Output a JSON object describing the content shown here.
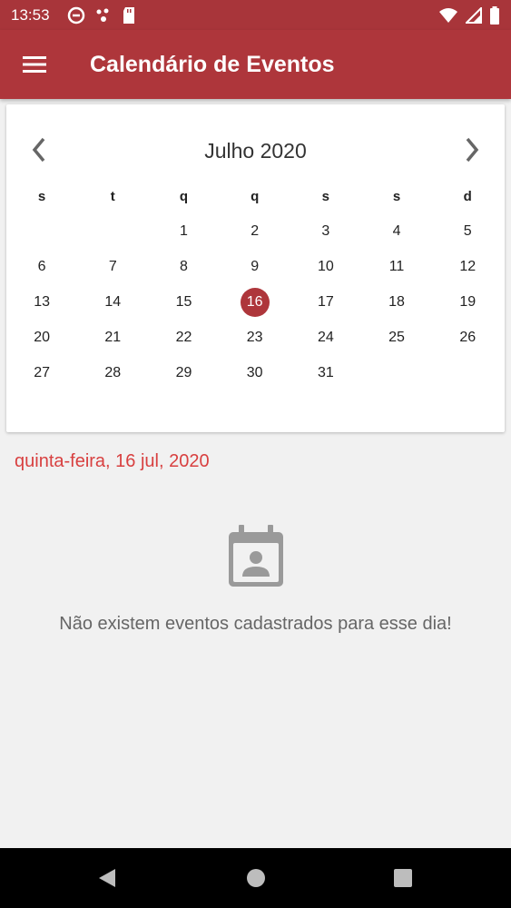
{
  "status_bar": {
    "time": "13:53"
  },
  "app_bar": {
    "title": "Calendário de Eventos"
  },
  "calendar": {
    "month_label": "Julho 2020",
    "weekdays": [
      "s",
      "t",
      "q",
      "q",
      "s",
      "s",
      "d"
    ],
    "days": [
      "",
      "",
      "1",
      "2",
      "3",
      "4",
      "5",
      "6",
      "7",
      "8",
      "9",
      "10",
      "11",
      "12",
      "13",
      "14",
      "15",
      "16",
      "17",
      "18",
      "19",
      "20",
      "21",
      "22",
      "23",
      "24",
      "25",
      "26",
      "27",
      "28",
      "29",
      "30",
      "31",
      "",
      ""
    ],
    "selected_day": "16"
  },
  "selected_date": "quinta-feira, 16 jul, 2020",
  "empty_state": {
    "message": "Não existem eventos cadastrados para esse dia!"
  },
  "colors": {
    "primary": "#ae363b",
    "accent_text": "#d84040"
  }
}
